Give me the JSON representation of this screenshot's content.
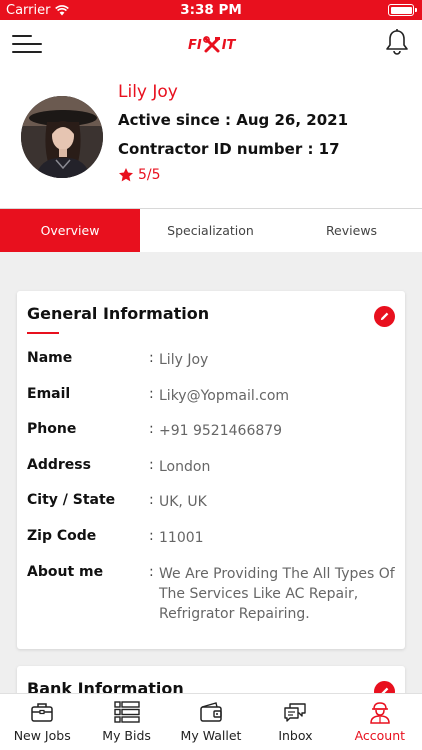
{
  "status_bar": {
    "carrier": "Carrier",
    "time": "3:38 PM"
  },
  "header": {
    "logo_left": "FI",
    "logo_right": "IT"
  },
  "profile": {
    "name": "Lily Joy",
    "active_since": "Active since : Aug 26, 2021",
    "contractor_id": "Contractor ID number : 17",
    "rating": "5/5"
  },
  "tabs": [
    {
      "label": "Overview"
    },
    {
      "label": "Specialization"
    },
    {
      "label": "Reviews"
    }
  ],
  "general": {
    "title": "General Information",
    "rows": [
      {
        "label": "Name",
        "value": "Lily Joy"
      },
      {
        "label": "Email",
        "value": "Liky@Yopmail.com"
      },
      {
        "label": "Phone",
        "value": "+91 9521466879"
      },
      {
        "label": "Address",
        "value": "London"
      },
      {
        "label": "City / State",
        "value": "UK, UK"
      },
      {
        "label": "Zip Code",
        "value": "11001"
      },
      {
        "label": "About me",
        "value": "We Are Providing The All Types Of The Services Like AC Repair, Refrigrator Repairing."
      }
    ],
    "colon": ":"
  },
  "bank": {
    "title": "Bank Information"
  },
  "bottom_nav": [
    {
      "label": "New Jobs",
      "icon": "briefcase-icon"
    },
    {
      "label": "My Bids",
      "icon": "list-icon"
    },
    {
      "label": "My Wallet",
      "icon": "wallet-icon"
    },
    {
      "label": "Inbox",
      "icon": "chat-icon"
    },
    {
      "label": "Account",
      "icon": "worker-icon"
    }
  ],
  "colors": {
    "accent": "#e8101e",
    "background": "#efefef"
  }
}
